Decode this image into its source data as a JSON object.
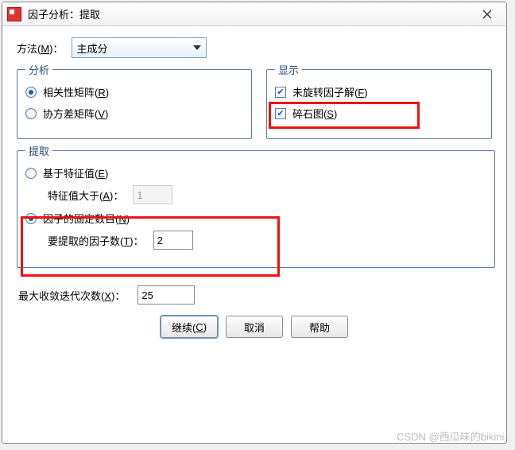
{
  "titlebar": {
    "title": "因子分析：提取"
  },
  "method": {
    "label_prefix": "方法(",
    "label_key": "M",
    "label_suffix": ")：",
    "selected": "主成分"
  },
  "group_analysis": {
    "legend": "分析",
    "opt_corr_prefix": "相关性矩阵(",
    "opt_corr_key": "R",
    "opt_corr_suffix": ")",
    "opt_cov_prefix": "协方差矩阵(",
    "opt_cov_key": "V",
    "opt_cov_suffix": ")"
  },
  "group_display": {
    "legend": "显示",
    "chk_unrot_prefix": "未旋转因子解(",
    "chk_unrot_key": "F",
    "chk_unrot_suffix": ")",
    "chk_scree_prefix": "碎石图(",
    "chk_scree_key": "S",
    "chk_scree_suffix": ")"
  },
  "group_extract": {
    "legend": "提取",
    "opt_eig_prefix": "基于特征值(",
    "opt_eig_key": "E",
    "opt_eig_suffix": ")",
    "eig_label_prefix": "特征值大于(",
    "eig_label_key": "A",
    "eig_label_suffix": ")：",
    "eig_value": "1",
    "opt_fixed_prefix": "因子的固定数目(",
    "opt_fixed_key": "N",
    "opt_fixed_suffix": ")",
    "fixed_label_prefix": "要提取的因子数(",
    "fixed_label_key": "T",
    "fixed_label_suffix": ")：",
    "fixed_value": "2"
  },
  "iter": {
    "label_prefix": "最大收敛迭代次数(",
    "label_key": "X",
    "label_suffix": ")：",
    "value": "25"
  },
  "buttons": {
    "continue_prefix": "继续(",
    "continue_key": "C",
    "continue_suffix": ")",
    "cancel": "取消",
    "help": "帮助"
  },
  "watermark": "CSDN @西瓜味的bikini."
}
